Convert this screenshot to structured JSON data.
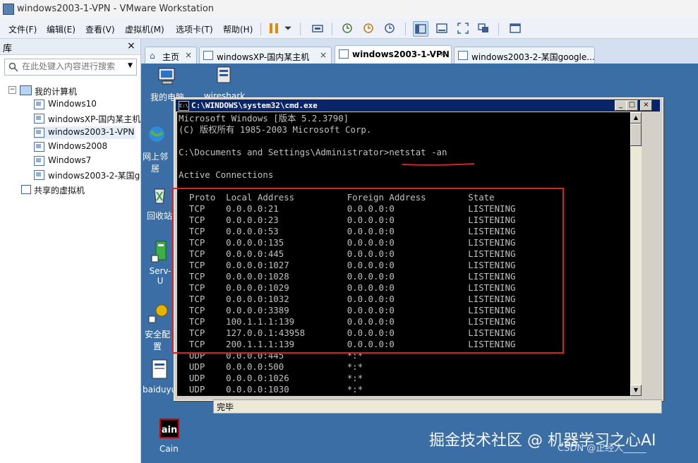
{
  "window": {
    "title": "windows2003-1-VPN - VMware Workstation"
  },
  "menu": [
    "文件(F)",
    "编辑(E)",
    "查看(V)",
    "虚拟机(M)",
    "选项卡(T)",
    "帮助(H)"
  ],
  "toolbar_icons": [
    "pause-icon",
    "dropdown-icon",
    "send-keys-icon",
    "snapshot-icon",
    "revert-snapshot-icon",
    "snapshot-manager-icon",
    "library-view-icon",
    "console-view-icon",
    "fullscreen-icon",
    "unity-icon",
    "thumbnail-icon"
  ],
  "library": {
    "title": "库",
    "close": "×",
    "search_placeholder": "在此处键入内容进行搜索",
    "root": "我的计算机",
    "vms": [
      "Windows10",
      "windowsXP-国内某主机",
      "windows2003-1-VPN",
      "Windows2008",
      "Windows7",
      "windows2003-2-某国google"
    ],
    "shared": "共享的虚拟机",
    "selected_index": 2
  },
  "tabs": [
    {
      "label": "主页",
      "active": false
    },
    {
      "label": "windowsXP-国内某主机",
      "active": false
    },
    {
      "label": "windows2003-1-VPN",
      "active": true
    },
    {
      "label": "windows2003-2-某国google...",
      "active": false
    }
  ],
  "desktop_icons": [
    "我的电脑",
    "wireshark",
    "网上邻居",
    "回收站",
    "Serv-U",
    "安全配置",
    "baiduyun",
    "Cain"
  ],
  "cmd": {
    "title": "C:\\WINDOWS\\system32\\cmd.exe",
    "header_lines": [
      "Microsoft Windows [版本 5.2.3790]",
      "(C) 版权所有 1985-2003 Microsoft Corp.",
      "",
      "C:\\Documents and Settings\\Administrator>netstat -an",
      "",
      "Active Connections",
      ""
    ],
    "columns": [
      "Proto",
      "Local Address",
      "Foreign Address",
      "State"
    ],
    "rows": [
      [
        "TCP",
        "0.0.0.0:21",
        "0.0.0.0:0",
        "LISTENING"
      ],
      [
        "TCP",
        "0.0.0.0:23",
        "0.0.0.0:0",
        "LISTENING"
      ],
      [
        "TCP",
        "0.0.0.0:53",
        "0.0.0.0:0",
        "LISTENING"
      ],
      [
        "TCP",
        "0.0.0.0:135",
        "0.0.0.0:0",
        "LISTENING"
      ],
      [
        "TCP",
        "0.0.0.0:445",
        "0.0.0.0:0",
        "LISTENING"
      ],
      [
        "TCP",
        "0.0.0.0:1027",
        "0.0.0.0:0",
        "LISTENING"
      ],
      [
        "TCP",
        "0.0.0.0:1028",
        "0.0.0.0:0",
        "LISTENING"
      ],
      [
        "TCP",
        "0.0.0.0:1029",
        "0.0.0.0:0",
        "LISTENING"
      ],
      [
        "TCP",
        "0.0.0.0:1032",
        "0.0.0.0:0",
        "LISTENING"
      ],
      [
        "TCP",
        "0.0.0.0:3389",
        "0.0.0.0:0",
        "LISTENING"
      ],
      [
        "TCP",
        "100.1.1.1:139",
        "0.0.0.0:0",
        "LISTENING"
      ],
      [
        "TCP",
        "127.0.0.1:43958",
        "0.0.0.0:0",
        "LISTENING"
      ],
      [
        "TCP",
        "200.1.1.1:139",
        "0.0.0.0:0",
        "LISTENING"
      ],
      [
        "UDP",
        "0.0.0.0:445",
        "*:*",
        ""
      ],
      [
        "UDP",
        "0.0.0.0:500",
        "*:*",
        ""
      ],
      [
        "UDP",
        "0.0.0.0:1026",
        "*:*",
        ""
      ],
      [
        "UDP",
        "0.0.0.0:1030",
        "*:*",
        ""
      ]
    ]
  },
  "statusbar": {
    "text": "完毕"
  },
  "watermark": {
    "main": "掘金技术社区 @ 机器学习之心AI",
    "sub": "CSDN @正经人_____"
  },
  "colors": {
    "desktop": "#3a6ea5",
    "cmd_title": "#0a246a",
    "annotation": "#d62222"
  }
}
